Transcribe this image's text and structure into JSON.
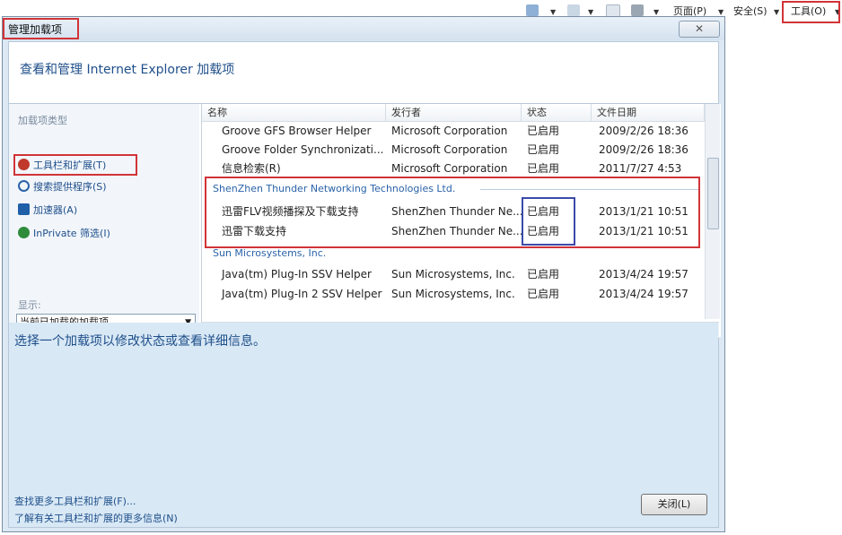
{
  "ie_toolbar": {
    "page": "页面(P)",
    "safety": "安全(S)",
    "tools": "工具(O)"
  },
  "dialog": {
    "title": "管理加载项",
    "close_glyph": "✕",
    "header": "查看和管理 Internet Explorer 加载项",
    "addon_types_label": "加载项类型",
    "addon_types": [
      {
        "label": "工具栏和扩展(T)",
        "icon": "gear-icon",
        "color": "#c0392b"
      },
      {
        "label": "搜索提供程序(S)",
        "icon": "search-icon",
        "color": "#2a62a8"
      },
      {
        "label": "加速器(A)",
        "icon": "accelerator-icon",
        "color": "#1f5fa8"
      },
      {
        "label": "InPrivate 筛选(I)",
        "icon": "inprivate-icon",
        "color": "#2e8b3a"
      }
    ],
    "show_label": "显示:",
    "show_value": "当前已加载的加载项",
    "columns": [
      "名称",
      "发行者",
      "状态",
      "文件日期"
    ],
    "groups": [
      {
        "name": "",
        "rows": [
          [
            "Groove GFS Browser Helper",
            "Microsoft Corporation",
            "已启用",
            "2009/2/26 18:36"
          ],
          [
            "Groove Folder Synchronizati...",
            "Microsoft Corporation",
            "已启用",
            "2009/2/26 18:36"
          ],
          [
            "信息检索(R)",
            "Microsoft Corporation",
            "已启用",
            "2011/7/27 4:53"
          ]
        ]
      },
      {
        "name": "ShenZhen Thunder Networking Technologies Ltd.",
        "rows": [
          [
            "迅雷FLV视频播探及下载支持",
            "ShenZhen Thunder Ne...",
            "已启用",
            "2013/1/21 10:51"
          ],
          [
            "迅雷下载支持",
            "ShenZhen Thunder Ne...",
            "已启用",
            "2013/1/21 10:51"
          ]
        ]
      },
      {
        "name": "Sun Microsystems, Inc.",
        "rows": [
          [
            "Java(tm) Plug-In SSV Helper",
            "Sun Microsystems, Inc.",
            "已启用",
            "2013/4/24 19:57"
          ],
          [
            "Java(tm) Plug-In 2 SSV Helper",
            "Sun Microsystems, Inc.",
            "已启用",
            "2013/4/24 19:57"
          ]
        ]
      }
    ],
    "info_text": "选择一个加载项以修改状态或查看详细信息。",
    "links": [
      "查找更多工具栏和扩展(F)...",
      "了解有关工具栏和扩展的更多信息(N)"
    ],
    "close_button": "关闭(L)"
  }
}
